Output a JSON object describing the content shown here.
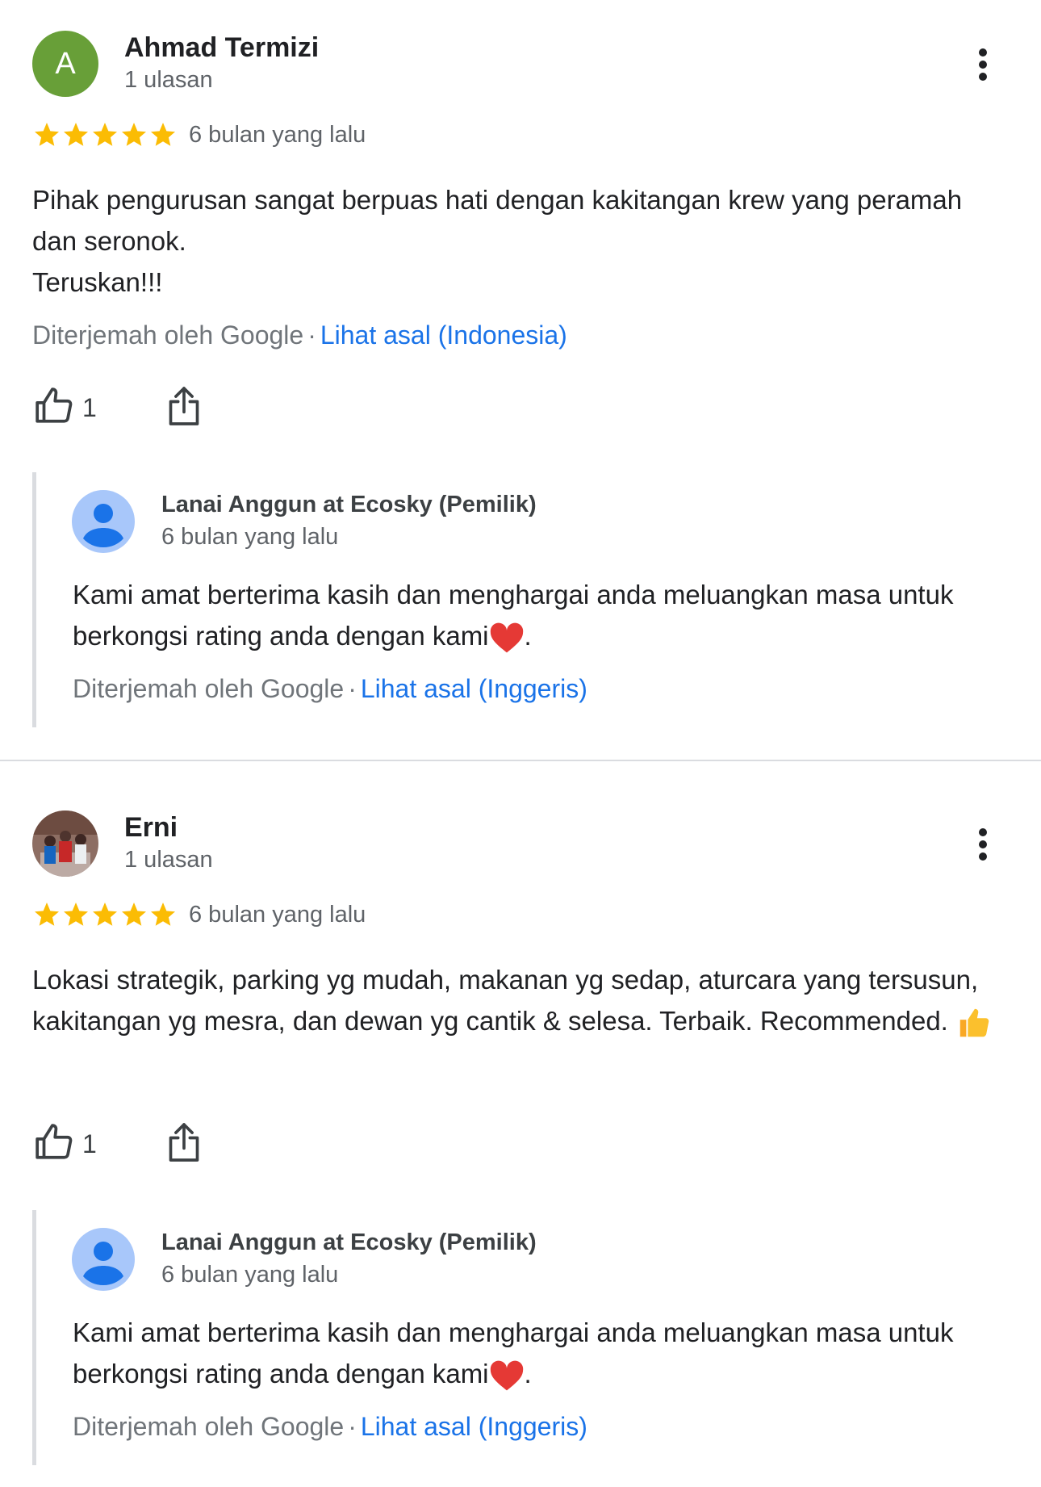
{
  "colors": {
    "link": "#1a73e8",
    "star": "#fbbc04",
    "avatar_green": "#689f38",
    "owner_avatar_bg": "#a8c7fa",
    "owner_avatar_fg": "#1a73e8"
  },
  "reviews": [
    {
      "avatar_letter": "A",
      "name": "Ahmad Termizi",
      "review_count": "1 ulasan",
      "rating": 5,
      "date": "6 bulan yang lalu",
      "text_lines": [
        "Pihak pengurusan sangat berpuas hati dengan kakitangan krew yang peramah dan seronok.",
        "Teruskan!!!"
      ],
      "translated_by": "Diterjemah oleh Google",
      "separator": "·",
      "original_link": "Lihat asal (Indonesia)",
      "likes": "1",
      "owner_reply": {
        "name": "Lanai Anggun at Ecosky (Pemilik)",
        "date": "6 bulan yang lalu",
        "text": "Kami amat berterima kasih dan menghargai anda meluangkan masa untuk berkongsi rating anda dengan kami",
        "text_end": ".",
        "translated_by": "Diterjemah oleh Google",
        "separator": "·",
        "original_link": "Lihat asal (Inggeris)"
      }
    },
    {
      "name": "Erni",
      "review_count": "1 ulasan",
      "rating": 5,
      "date": "6 bulan yang lalu",
      "text": "Lokasi strategik, parking yg mudah, makanan yg sedap, aturcara yang tersusun, kakitangan yg mesra, dan dewan yg cantik & selesa. Terbaik. Recommended.",
      "likes": "1",
      "owner_reply": {
        "name": "Lanai Anggun at Ecosky (Pemilik)",
        "date": "6 bulan yang lalu",
        "text": "Kami amat berterima kasih dan menghargai anda meluangkan masa untuk berkongsi rating anda dengan kami",
        "text_end": ".",
        "translated_by": "Diterjemah oleh Google",
        "separator": "·",
        "original_link": "Lihat asal (Inggeris)"
      }
    }
  ]
}
